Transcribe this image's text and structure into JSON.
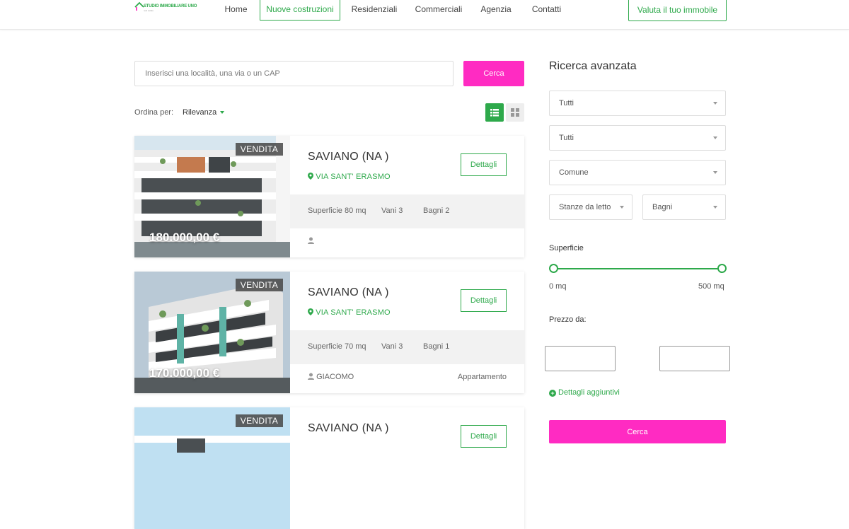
{
  "logo": {
    "text": "STUDIO IMMOBILIARE UNO",
    "subtext": "real estate"
  },
  "nav": [
    {
      "label": "Home"
    },
    {
      "label": "Nuove costruzioni"
    },
    {
      "label": "Residenziali"
    },
    {
      "label": "Commerciali"
    },
    {
      "label": "Agenzia"
    },
    {
      "label": "Contatti"
    }
  ],
  "header": {
    "cta_label": "Valuta il tuo immobile"
  },
  "search": {
    "placeholder": "Inserisci una località, una via o un CAP",
    "button_label": "Cerca"
  },
  "sort": {
    "label": "Ordina per:",
    "value": "Rilevanza"
  },
  "listings": [
    {
      "badge": "VENDITA",
      "price": "180.000,00 €",
      "title": "SAVIANO (NA )",
      "address": "VIA SANT' ERASMO",
      "details_label": "Dettagli",
      "surface": "Superficie 80 mq",
      "rooms": "Vani 3",
      "baths": "Bagni 2",
      "agent": "",
      "type": ""
    },
    {
      "badge": "VENDITA",
      "price": "170.000,00 €",
      "title": "SAVIANO (NA )",
      "address": "VIA SANT' ERASMO",
      "details_label": "Dettagli",
      "surface": "Superficie 70 mq",
      "rooms": "Vani 3",
      "baths": "Bagni 1",
      "agent": "GIACOMO",
      "type": "Appartamento"
    },
    {
      "badge": "VENDITA",
      "price": "",
      "title": "SAVIANO (NA )",
      "address": "",
      "details_label": "Dettagli",
      "surface": "",
      "rooms": "",
      "baths": "",
      "agent": "",
      "type": ""
    }
  ],
  "sidebar": {
    "title": "Ricerca avanzata",
    "select1": "Tutti",
    "select2": "Tutti",
    "select3": "Comune",
    "bedrooms": "Stanze da letto",
    "baths": "Bagni",
    "surface_label": "Superficie",
    "surface_min": "0 mq",
    "surface_max": "500 mq",
    "price_label": "Prezzo da:",
    "more_label": "Dettagli aggiuntivi",
    "button_label": "Cerca"
  },
  "colors": {
    "accent": "#2ea94b",
    "cta": "#ff2bc2"
  }
}
